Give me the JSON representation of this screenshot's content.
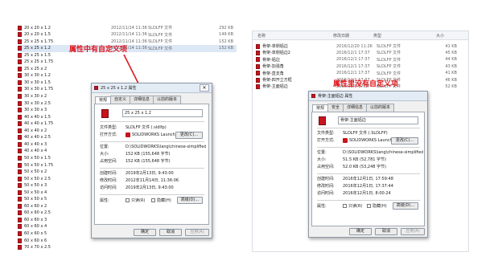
{
  "left_list": {
    "rows": [
      {
        "name": "20 x 20 x 1.2",
        "date": "2012/11/14 11:36",
        "type": "SLDLFP 文件",
        "size": "292 KB"
      },
      {
        "name": "20 x 20 x 1.5",
        "date": "2012/11/14 11:36",
        "type": "SLDLFP 文件",
        "size": "149 KB"
      },
      {
        "name": "25 x 25 x 1.75",
        "date": "2012/11/14 11:36",
        "type": "SLDLFP 文件",
        "size": "152 KB"
      },
      {
        "name": "25 x 25 x 1.2",
        "date": "2012/11/14 11:36",
        "type": "SLDLFP 文件",
        "size": "152 KB"
      },
      {
        "name": "25 x 25 x 1.5",
        "date": "",
        "type": "",
        "size": ""
      },
      {
        "name": "25 x 25 x 1.75",
        "date": "",
        "type": "",
        "size": ""
      },
      {
        "name": "25 x 25 x 2",
        "date": "",
        "type": "",
        "size": ""
      },
      {
        "name": "30 x 30 x 1.2",
        "date": "",
        "type": "",
        "size": ""
      },
      {
        "name": "30 x 30 x 1.5",
        "date": "",
        "type": "",
        "size": ""
      },
      {
        "name": "30 x 30 x 1.75",
        "date": "",
        "type": "",
        "size": ""
      },
      {
        "name": "30 x 30 x 2",
        "date": "",
        "type": "",
        "size": ""
      },
      {
        "name": "30 x 30 x 2.5",
        "date": "",
        "type": "",
        "size": ""
      },
      {
        "name": "30 x 30 x 3",
        "date": "",
        "type": "",
        "size": ""
      },
      {
        "name": "40 x 40 x 1.5",
        "date": "",
        "type": "",
        "size": ""
      },
      {
        "name": "40 x 40 x 1.75",
        "date": "",
        "type": "",
        "size": ""
      },
      {
        "name": "40 x 40 x 2",
        "date": "",
        "type": "",
        "size": ""
      },
      {
        "name": "40 x 40 x 2.5",
        "date": "",
        "type": "",
        "size": ""
      },
      {
        "name": "40 x 40 x 3",
        "date": "",
        "type": "",
        "size": ""
      },
      {
        "name": "40 x 40 x 4",
        "date": "",
        "type": "",
        "size": ""
      },
      {
        "name": "50 x 50 x 1.5",
        "date": "",
        "type": "",
        "size": ""
      },
      {
        "name": "50 x 50 x 1.75",
        "date": "",
        "type": "",
        "size": ""
      },
      {
        "name": "50 x 50 x 2",
        "date": "",
        "type": "",
        "size": ""
      },
      {
        "name": "50 x 50 x 2.5",
        "date": "",
        "type": "",
        "size": ""
      },
      {
        "name": "50 x 50 x 3",
        "date": "",
        "type": "",
        "size": ""
      },
      {
        "name": "50 x 50 x 4",
        "date": "",
        "type": "",
        "size": ""
      },
      {
        "name": "50 x 50 x 5",
        "date": "",
        "type": "",
        "size": ""
      },
      {
        "name": "60 x 60 x 2",
        "date": "",
        "type": "",
        "size": ""
      },
      {
        "name": "60 x 60 x 2.5",
        "date": "",
        "type": "",
        "size": ""
      },
      {
        "name": "60 x 60 x 3",
        "date": "",
        "type": "",
        "size": ""
      },
      {
        "name": "60 x 60 x 4",
        "date": "",
        "type": "",
        "size": ""
      },
      {
        "name": "60 x 60 x 5",
        "date": "",
        "type": "",
        "size": ""
      },
      {
        "name": "60 x 60 x 6",
        "date": "",
        "type": "",
        "size": ""
      },
      {
        "name": "70 x 70 x 2.5",
        "date": "",
        "type": "",
        "size": ""
      }
    ],
    "selected_index": 3
  },
  "left_annotation": "属性中有自定义项",
  "left_dialog": {
    "title": "25 x 25 x 1.2 属性",
    "close_glyph": "✕",
    "tabs": [
      "常规",
      "自定义",
      "详细信息",
      "以前的版本"
    ],
    "name_value": "25 x 25 x 1.2",
    "file_type_label": "文件类型:",
    "file_type_value": "SLDLFP 文件 (.sldlfp)",
    "opens_with_label": "打开方式:",
    "opens_with_value": "SOLIDWORKS Launcher",
    "change_button": "更改(C)...",
    "location_label": "位置:",
    "location_value": "D:\\SOLIDWORKS\\lang\\chinese-simplified\\weldment profiles",
    "size_label": "大小:",
    "size_value": "152 KB (155,648 字节)",
    "disk_size_label": "占用空间:",
    "disk_size_value": "152 KB (155,648 字节)",
    "created_label": "创建时间:",
    "created_value": "2019年2月13日, 9:43:00",
    "modified_label": "修改时间:",
    "modified_value": "2012年11月14日, 11:36:06",
    "accessed_label": "访问时间:",
    "accessed_value": "2019年2月13日, 9:43:00",
    "attributes_label": "属性:",
    "readonly_label": "只读(R)",
    "hidden_label": "隐藏(H)",
    "advanced_button": "高级(D)...",
    "ok_button": "确定",
    "cancel_button": "取消",
    "apply_button": "应用(A)"
  },
  "right_list": {
    "headers": {
      "name": "名称",
      "date": "修改日期",
      "type": "类型",
      "size": "大小"
    },
    "rows": [
      {
        "name": "骨架-单侧铝边",
        "date": "2016/12/20 11:26",
        "type": "SLDLFP 文件",
        "size": "41 KB"
      },
      {
        "name": "骨架-单侧铝边2",
        "date": "2016/12/1 17:37",
        "type": "SLDLFP 文件",
        "size": "45 KB"
      },
      {
        "name": "骨架-铝边",
        "date": "2016/12/1 17:37",
        "type": "SLDLFP 文件",
        "size": "44 KB"
      },
      {
        "name": "骨架-加强角",
        "date": "2016/12/1 17:37",
        "type": "SLDLFP 文件",
        "size": "43 KB"
      },
      {
        "name": "骨架-直支角",
        "date": "2016/12/1 17:37",
        "type": "SLDLFP 文件",
        "size": "41 KB"
      },
      {
        "name": "骨架-四开立方框",
        "date": "2016/12/1 17:37",
        "type": "SLDLFP 文件",
        "size": "46 KB"
      },
      {
        "name": "骨架-主面铝边",
        "date": "2016/12/1 17:37",
        "type": "SLDLFP 文件",
        "size": "52 KB"
      }
    ]
  },
  "right_annotation": "属性里没有自定义项",
  "right_dialog": {
    "title": "骨架-主面铝边 属性",
    "close_glyph": "✕",
    "tabs": [
      "常规",
      "安全",
      "详细信息",
      "以前的版本"
    ],
    "name_value": "骨架-主面铝边",
    "file_type_label": "文件类型:",
    "file_type_value": "SLDLFP 文件 (.SLDLFP)",
    "opens_with_label": "打开方式:",
    "opens_with_value": "SOLIDWORKS Launcher",
    "change_button": "更改(C)...",
    "location_label": "位置:",
    "location_value": "D:\\SOLIDWORKS\\lang\\chinese-simplified\\weldment profiles",
    "size_label": "大小:",
    "size_value": "51.5 KB (52,781 字节)",
    "disk_size_label": "占用空间:",
    "disk_size_value": "52.0 KB (53,248 字节)",
    "created_label": "创建时间:",
    "created_value": "2016年12月1日, 17:59:48",
    "modified_label": "修改时间:",
    "modified_value": "2016年12月1日, 17:37:44",
    "accessed_label": "访问时间:",
    "accessed_value": "2016年12月1日, 8:00:24",
    "attributes_label": "属性:",
    "readonly_label": "只读(R)",
    "hidden_label": "隐藏(H)",
    "advanced_button": "高级(D)...",
    "ok_button": "确定",
    "cancel_button": "取消",
    "apply_button": "应用(A)"
  }
}
